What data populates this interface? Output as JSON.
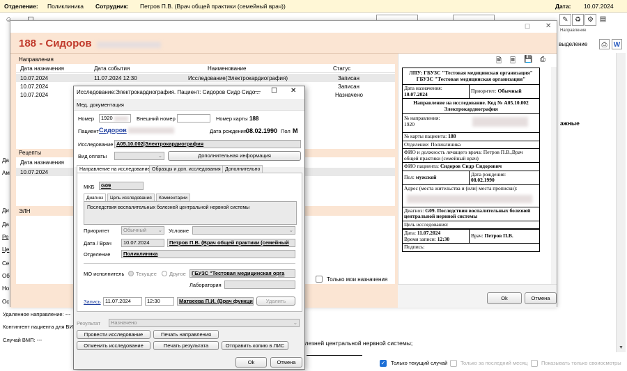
{
  "topbar": {
    "dept_label": "Отделение:",
    "dept_value": "Поликлиника",
    "emp_label": "Сотрудник:",
    "emp_value": "Петров П.В. (Врач общей практики (семейный врач))",
    "date_label": "Дата:",
    "date_value": "10.07.2024"
  },
  "main_window": {
    "title": "188 - Сидоров",
    "right_label": "Направление",
    "right_label2": "выделение",
    "bold_fragment": "ажные"
  },
  "directions": {
    "header": "Направления",
    "columns": [
      "Дата назначения",
      "Дата события",
      "Наименование",
      "Статус"
    ],
    "rows": [
      {
        "date": "10.07.2024",
        "event": "11.07.2024 12:30",
        "name": "Исследование(Электрокардиография)",
        "status": "Записан"
      },
      {
        "date": "10.07.2024",
        "event": "",
        "name": "",
        "status": "Записан"
      },
      {
        "date": "10.07.2024",
        "event": "",
        "name": "",
        "status": "Назначено"
      }
    ]
  },
  "recipes": {
    "header": "Рецепты",
    "col": "Дата назначения",
    "rows": [
      "10.07.2024"
    ]
  },
  "eln": {
    "header": "ЭЛН"
  },
  "left_fragments": [
    "Да",
    "Ам",
    "Ди",
    "Да",
    "Ре",
    "Це",
    "Се",
    "Об",
    "Но",
    "Ос"
  ],
  "left_bottom": {
    "remote": "Удаленное направление: ---",
    "contingent": "Контингент пациента для ВИЧ",
    "vmp": "Случай ВМП: ---"
  },
  "bottom_text": {
    "fragment1": "олезней центральной нервной системы;",
    "checkbox_mine": "Только мои назначения",
    "cb_current": "Только текущий случай",
    "cb_last_month": "Только за последний месяц",
    "cb_own": "Показывать только своиосмотры"
  },
  "outer_buttons": {
    "ok": "Ok",
    "cancel": "Отмена"
  },
  "dialog": {
    "title": "Исследование:Электрокардиография. Пациент: Сидоров Сидр Сидо...",
    "menu": "Мед. документация",
    "number_label": "Номер",
    "number_value": "1920",
    "ext_number_label": "Внешний номер",
    "card_label": "Номер карты",
    "card_value": "188",
    "patient_label": "Пациент",
    "patient_value": "Сидоров",
    "dob_label": "Дата рождения",
    "dob_value": "08.02.1990",
    "sex_label": "Пол",
    "sex_value": "М",
    "research_label": "Исследование",
    "research_value": "A05.10.002|Электрокардиография",
    "payment_label": "Вид оплаты",
    "extra_info_btn": "Дополнительная информация",
    "tabs": [
      "Направление на исследование",
      "Образцы и доп. исследования",
      "Дополнительно"
    ],
    "mkb_label": "МКБ",
    "mkb_value": "G09",
    "subtabs": [
      "Диагноз",
      "Цель исследования",
      "Комментарии"
    ],
    "diagnosis_text": "Последствия воспалительных болезней центральной нервной системы",
    "priority_label": "Приоритет",
    "priority_value": "Обычный",
    "condition_label": "Условие",
    "date_doctor_label": "Дата / Врач",
    "date_value": "10.07.2024",
    "doctor_value": "Петров П.В. (Врач общей практики (семейный",
    "dept_label": "Отделение",
    "dept_value": "Поликлиника",
    "mo_label": "МО исполнитель",
    "mo_current": "Текущее",
    "mo_other": "Другое",
    "mo_value": "ГБУЗС \"Тестовая медицинская орга",
    "lab_label": "Лаборатория",
    "record_link": "Запись",
    "record_date": "11.07.2024",
    "record_time": "12:30",
    "record_doctor": "Матвеева П.И. (Врач функцион",
    "delete_btn": "Удалить",
    "result_label": "Результат",
    "result_value": "Назначено",
    "btn_conduct": "Провести исследование",
    "btn_print_dir": "Печать направления",
    "btn_cancel_research": "Отменить исследование",
    "btn_print_result": "Печать результата",
    "btn_send_copy": "Отправить копию в ЛИС",
    "ok": "Ok",
    "cancel": "Отмена"
  },
  "print_doc": {
    "lpu": "ЛПУ: ГБУЗС \"Тестовая медицинская организация\" ГБУЗС \"Тестовая медицинская организация\"",
    "assign_date_label": "Дата назначения:",
    "assign_date": "10.07.2024",
    "priority_label": "Приоритет:",
    "priority": "Обычный",
    "heading": "Направление на исследование. Код № A05.10.002 Электрокардиография",
    "dir_no_label": "№ направления:",
    "dir_no": "1920",
    "card_label": "№ карты пациента:",
    "card": "188",
    "dept": "Отделение: Поликлиника",
    "doctor": "ФИО и должность лечащего врача: Петров П.В.,Врач общей практики (семейный врач)",
    "fio_label": "ФИО пациента:",
    "fio": "Сидоров Сидр Сидорович",
    "sex_label": "Пол:",
    "sex": "мужской",
    "dob_label": "Дата рождения:",
    "dob": "08.02.1990",
    "address": "Адрес (места жительства и (или) места прописки):",
    "diag_label": "Диагноз:",
    "diag": "G09. Последствия воспалительных болезней центральной нервной системы",
    "goal": "Цель исследования:",
    "date_label": "Дата:",
    "date": "11.07.2024",
    "time_label": "Время записи:",
    "time": "12:30",
    "doc_label": "Врач:",
    "doc": "Петров П.В.",
    "sign": "Подпись:"
  }
}
